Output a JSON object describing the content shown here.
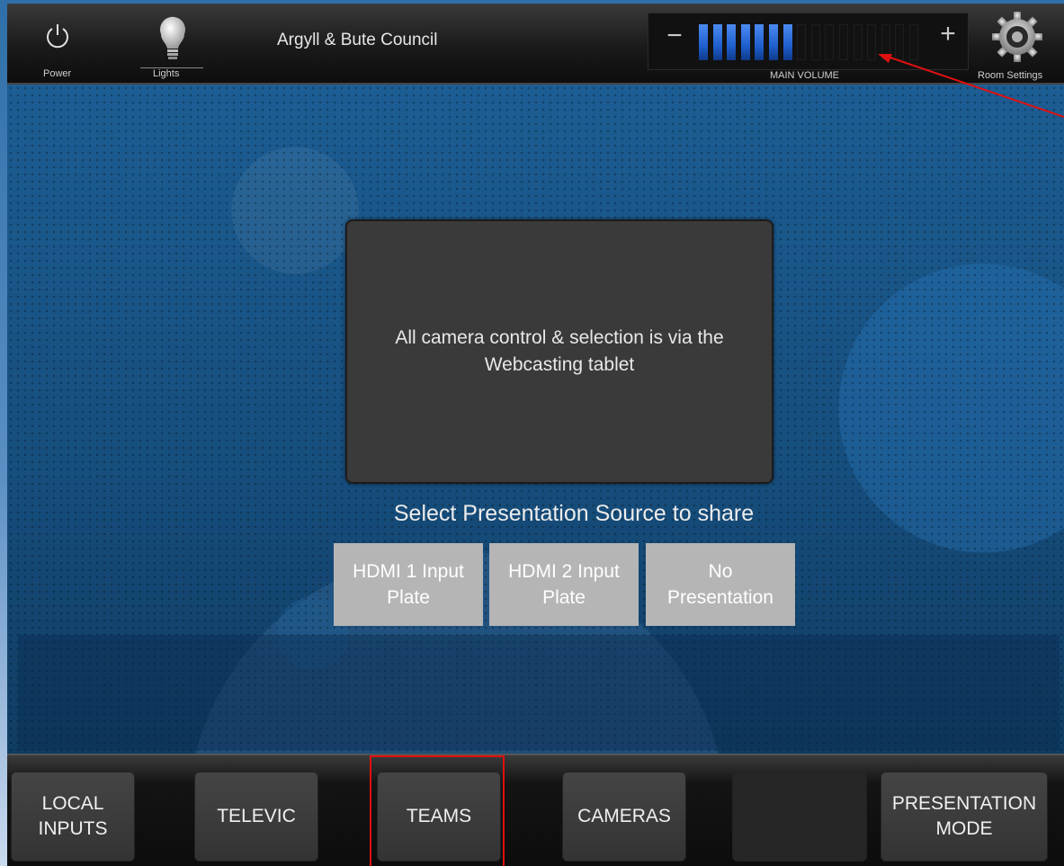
{
  "header": {
    "title": "Argyll & Bute Council",
    "power_label": "Power",
    "lights_label": "Lights",
    "volume_label": "MAIN VOLUME",
    "volume_minus": "−",
    "volume_plus": "+",
    "volume_level": 0.44,
    "volume_segments_total": 16,
    "settings_label": "Room Settings",
    "icons": {
      "power": "power-icon",
      "lights": "lightbulb-icon",
      "settings": "gear-icon"
    }
  },
  "main": {
    "message": "All camera control & selection is via the Webcasting tablet",
    "select_title": "Select Presentation Source to share",
    "sources": [
      {
        "label": "HDMI 1 Input Plate"
      },
      {
        "label": "HDMI 2 Input Plate"
      },
      {
        "label": "No Presentation"
      }
    ]
  },
  "nav": {
    "items": [
      {
        "label": "LOCAL INPUTS"
      },
      {
        "label": "TELEVIC"
      },
      {
        "label": "TEAMS"
      },
      {
        "label": "CAMERAS"
      },
      {
        "label": ""
      },
      {
        "label": "PRESENTATION MODE"
      }
    ]
  },
  "colors": {
    "volume_active": "#1f5fcf",
    "volume_inactive": "#121212",
    "highlight": "#e01010",
    "source_button": "#b5b5b5"
  }
}
